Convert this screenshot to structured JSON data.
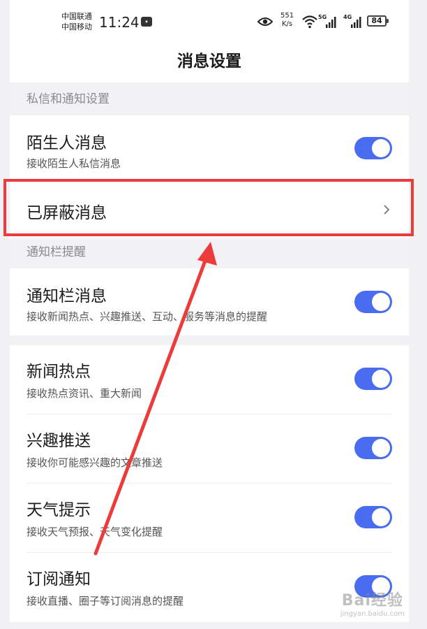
{
  "status_bar": {
    "carrier_1": "中国联通",
    "carrier_2": "中国移动",
    "time": "11:24",
    "net_speed_value": "551",
    "net_speed_unit": "K/s",
    "signal_1_label": "5G",
    "signal_2_label": "4G",
    "battery": "84"
  },
  "header": {
    "title": "消息设置"
  },
  "sections": {
    "private": {
      "label": "私信和通知设置",
      "stranger": {
        "title": "陌生人消息",
        "subtitle": "接收陌生人私信消息",
        "enabled": true
      },
      "blocked": {
        "title": "已屏蔽消息"
      }
    },
    "notify_bar": {
      "label": "通知栏提醒",
      "notify_msg": {
        "title": "通知栏消息",
        "subtitle": "接收新闻热点、兴趣推送、互动、服务等消息的提醒",
        "enabled": true
      }
    },
    "topics": {
      "news": {
        "title": "新闻热点",
        "subtitle": "接收热点资讯、重大新闻",
        "enabled": true
      },
      "interest": {
        "title": "兴趣推送",
        "subtitle": "接收你可能感兴趣的文章推送",
        "enabled": true
      },
      "weather": {
        "title": "天气提示",
        "subtitle": "接收天气预报、天气变化提醒",
        "enabled": true
      },
      "subscribe": {
        "title": "订阅通知",
        "subtitle": "接收直播、圈子等订阅消息的提醒",
        "enabled": true
      }
    }
  },
  "colors": {
    "toggle_on": "#4a6cf0",
    "highlight": "#ec3b3b"
  },
  "watermark": {
    "main": "Bai经验",
    "sub": "jingyan.baidu.com"
  }
}
